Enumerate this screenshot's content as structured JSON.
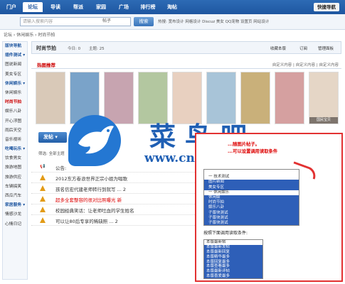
{
  "nav": {
    "items": [
      "门户",
      "论坛",
      "导读",
      "帮派",
      "家园",
      "广场",
      "排行榜",
      "淘帖"
    ],
    "active": 1,
    "quick": "快捷导航"
  },
  "search": {
    "placeholder": "请输入搜索内容",
    "scope": "帖子",
    "button": "搜索",
    "hot": "热搜: 宽布设计 网格设计 Discuz 美女 QQ宠物 设置页 网站设计"
  },
  "breadcrumb": "论坛 › 休闲娱乐 › 时尚节拍",
  "sidebar": [
    {
      "label": "版块导航",
      "type": "hd"
    },
    {
      "label": "插件测试 ▾",
      "type": "hd"
    },
    {
      "label": "图说新闻"
    },
    {
      "label": "美女专区"
    },
    {
      "label": "休闲娱乐 ▾",
      "type": "hd"
    },
    {
      "label": "休闲娱乐"
    },
    {
      "label": "时尚节拍",
      "type": "cur"
    },
    {
      "label": "娱乐八卦"
    },
    {
      "label": "开心浮图"
    },
    {
      "label": "雨后天空"
    },
    {
      "label": "音乐视听"
    },
    {
      "label": "吃喝玩乐 ▾",
      "type": "hd"
    },
    {
      "label": "饮食男女"
    },
    {
      "label": "旅游地图"
    },
    {
      "label": "旅游供应"
    },
    {
      "label": "车辆搞笑"
    },
    {
      "label": "西瓜汽车"
    },
    {
      "label": "家居服务 ▾",
      "type": "hd"
    },
    {
      "label": "情感沙龙"
    },
    {
      "label": "心情日记"
    }
  ],
  "forum": {
    "title": "时尚节拍",
    "today": "今日: 0",
    "threads": "主题: 25",
    "fav": "收藏本版",
    "sub": "订阅",
    "manage": "管理面板"
  },
  "hot": {
    "title": "热图推荐",
    "actions": "自定义内容 | 自定义内容 | 自定义内容"
  },
  "photos": [
    {
      "cap": "",
      "color": "#d9c9b8"
    },
    {
      "cap": "",
      "color": "#7aa3c9"
    },
    {
      "cap": "",
      "color": "#c7a4b0"
    },
    {
      "cap": "",
      "color": "#b3c7a0"
    },
    {
      "cap": "",
      "color": "#e8d0c0"
    },
    {
      "cap": "",
      "color": "#a8c4d8"
    },
    {
      "cap": "",
      "color": "#c9b07a"
    },
    {
      "cap": "",
      "color": "#d5a0a0"
    },
    {
      "cap": "国民宝贝",
      "color": "#e5d6c6"
    }
  ],
  "post_button": "发帖 ▾",
  "filter": "筛选: 全部主题",
  "threads": [
    {
      "title": "公告: ",
      "pre": "",
      "color": "#333",
      "icon": "notice"
    },
    {
      "title": "2012东方卷浪世界正宗小姐为唱歌",
      "pre": "",
      "color": "#333",
      "icon": "up"
    },
    {
      "title": "孩名信宏代建老师转行到就写 ... 2",
      "pre": "",
      "color": "#333",
      "icon": "up"
    },
    {
      "title": "超多全套整容的很对比照曝光 新",
      "pre": "",
      "color": "#d00",
      "icon": "up"
    },
    {
      "title": "校园经典笑话：让老师吐血的学生姓名",
      "pre": "",
      "color": "#333",
      "icon": "up"
    },
    {
      "title": "可以让80后专享的稀缺照 ... 2",
      "pre": "",
      "color": "#333",
      "icon": "up"
    }
  ],
  "watermark": {
    "text": "菜鸟吧",
    "url": "www.cniao8.com"
  },
  "popup": {
    "note1": "...随图片帖子。",
    "note2": "...可以设置调用读取条件",
    "list1": [
      {
        "t": "",
        "s": false
      },
      {
        "t": "一 技术测试",
        "s": false
      },
      {
        "t": "图片新闻",
        "s": true
      },
      {
        "t": "美女专区",
        "s": true
      },
      {
        "t": "一 休闲娱乐",
        "s": false
      },
      {
        "t": "休闲娱",
        "s": true
      },
      {
        "t": "时尚节拍",
        "s": true
      },
      {
        "t": "娱乐八卦",
        "s": true
      },
      {
        "t": "子版块测试",
        "s": true
      },
      {
        "t": "子版块测试",
        "s": true
      },
      {
        "t": "子版块测试",
        "s": true
      }
    ],
    "label": "按照下面调用读取条件:",
    "list2": [
      {
        "t": "本版最新帖",
        "s": false
      },
      {
        "t": "本版最新发帖",
        "s": true
      },
      {
        "t": "本版最新回复",
        "s": true
      },
      {
        "t": "本版精华最多",
        "s": true
      },
      {
        "t": "本版回复最多",
        "s": true
      },
      {
        "t": "本版查看最多",
        "s": true
      },
      {
        "t": "本版最新评帖",
        "s": true
      },
      {
        "t": "本版喜爱最多",
        "s": true
      }
    ]
  }
}
